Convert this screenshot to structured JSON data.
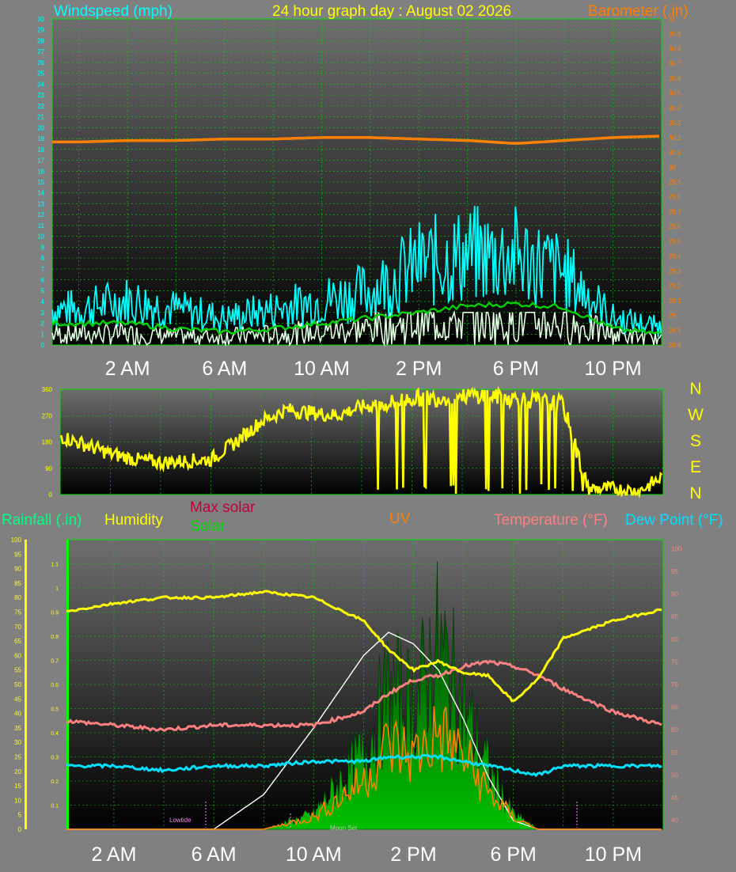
{
  "header": {
    "title": "24 hour graph day : August 02 2026",
    "left_label": "Windspeed (mph)",
    "right_label": "Barometer (.in)"
  },
  "time_labels": [
    "2 AM",
    "6 AM",
    "10 AM",
    "2 PM",
    "6 PM",
    "10 PM"
  ],
  "legend": {
    "rainfall": "Rainfall (.in)",
    "humidity": "Humidity",
    "max_solar": "Max solar",
    "solar": "Solar",
    "uv": "UV",
    "temperature": "Temperature (°F)",
    "dew_point": "Dew Point (°F)"
  },
  "direction_letters": [
    "N",
    "W",
    "S",
    "E",
    "N"
  ],
  "annotations": {
    "lowtide": "Lowtide",
    "moonset": "Moon Set"
  },
  "colors": {
    "background": "#808080",
    "plot_top": "#707070",
    "plot_bottom": "#000000",
    "grid": "#00e000",
    "wind": "#00ffff",
    "gust_white": "#e0ffe0",
    "wind_avg": "#00d000",
    "barometer": "#ff8000",
    "direction": "#ffff00",
    "humidity": "#ffff00",
    "temperature": "#ff8080",
    "dew_point": "#00e0ff",
    "uv": "#ff8000",
    "solar": "#00a000",
    "max_solar": "#ffffff",
    "rain_axis": "#ffff00",
    "marker": "#ff80ff"
  },
  "chart_data": [
    {
      "type": "line",
      "name": "wind_barometer",
      "x_hours": [
        0,
        2,
        4,
        6,
        8,
        10,
        12,
        14,
        16,
        18,
        20,
        22,
        24
      ],
      "left_axis": {
        "ticks": [
          0,
          1,
          2,
          3,
          4,
          5,
          6,
          7,
          8,
          9,
          10,
          11,
          12,
          13,
          14,
          15,
          16,
          17,
          18,
          19,
          20,
          21,
          22,
          23,
          24,
          25,
          26,
          27,
          28,
          29,
          30
        ],
        "ylim": [
          0,
          30
        ]
      },
      "right_axis": {
        "ticks": [
          "28.8",
          "28.9",
          "29",
          "29.1",
          "29.2",
          "29.3",
          "29.4",
          "29.5",
          "29.6",
          "29.7",
          "29.8",
          "29.9",
          "30",
          "30.1",
          "30.2",
          "30.3",
          "30.4",
          "30.5",
          "30.6",
          "30.7",
          "30.8",
          "30.9",
          "31"
        ],
        "ylim": [
          28.8,
          31
        ]
      },
      "series": [
        {
          "key": "wind_gust",
          "values": [
            4,
            5,
            4,
            3,
            4,
            5,
            6,
            9,
            10,
            10,
            8,
            3,
            2
          ]
        },
        {
          "key": "wind_avg",
          "values": [
            2,
            2,
            1.5,
            1.2,
            1.5,
            2,
            2.5,
            3,
            3.6,
            3.8,
            3.5,
            1.5,
            1
          ]
        },
        {
          "key": "wind_speed",
          "values": [
            1,
            1,
            0.8,
            0.8,
            1,
            1.2,
            1.5,
            2,
            2.3,
            2.3,
            2,
            1,
            0.5
          ]
        },
        {
          "key": "barometer",
          "values": [
            30.17,
            30.18,
            30.18,
            30.19,
            30.19,
            30.2,
            30.2,
            30.19,
            30.18,
            30.16,
            30.18,
            30.2,
            30.21
          ]
        }
      ]
    },
    {
      "type": "line",
      "name": "wind_direction",
      "x_hours": [
        0,
        1,
        2,
        3,
        4,
        5,
        6,
        7,
        8,
        9,
        10,
        11,
        12,
        13,
        14,
        15,
        16,
        17,
        18,
        19,
        20,
        21,
        22,
        23,
        24
      ],
      "axis": {
        "ticks": [
          0,
          90,
          180,
          270,
          360
        ],
        "ylim": [
          0,
          360
        ]
      },
      "values": [
        200,
        170,
        140,
        120,
        110,
        115,
        120,
        180,
        250,
        290,
        280,
        270,
        300,
        310,
        330,
        330,
        340,
        340,
        330,
        320,
        310,
        20,
        20,
        10,
        60
      ]
    },
    {
      "type": "line",
      "name": "temperature_humidity",
      "x_hours": [
        0,
        2,
        4,
        6,
        8,
        10,
        12,
        13,
        14,
        15,
        16,
        17,
        18,
        19,
        20,
        22,
        24
      ],
      "left_axis": {
        "ticks": [
          0,
          5,
          10,
          15,
          20,
          25,
          30,
          35,
          40,
          45,
          50,
          55,
          60,
          65,
          70,
          75,
          80,
          85,
          90,
          95,
          100
        ],
        "ylim": [
          0,
          100
        ]
      },
      "rain_axis": {
        "ticks": [
          "0.1",
          "0.2",
          "0.3",
          "0.4",
          "0.5",
          "0.6",
          "0.7",
          "0.8",
          "0.9",
          "1",
          "1.1"
        ],
        "ylim": [
          0,
          1.2
        ]
      },
      "right_axis": {
        "ticks": [
          40,
          45,
          50,
          55,
          60,
          65,
          70,
          75,
          80,
          85,
          90,
          95,
          100
        ],
        "ylim": [
          38,
          102
        ]
      },
      "series": [
        {
          "key": "humidity",
          "values": [
            75,
            78,
            80,
            80,
            82,
            80,
            72,
            62,
            55,
            58,
            54,
            53,
            44,
            52,
            66,
            72,
            76
          ]
        },
        {
          "key": "temperature",
          "values": [
            62,
            61,
            60,
            61,
            61,
            61,
            64,
            68,
            71,
            72,
            74,
            75,
            74,
            72,
            69,
            64,
            61
          ]
        },
        {
          "key": "dew_point",
          "values": [
            52,
            52,
            51,
            52,
            52,
            53,
            53,
            54,
            54,
            54,
            53,
            52,
            51,
            50,
            52,
            52,
            52
          ]
        },
        {
          "key": "uv",
          "values": [
            0,
            0,
            0,
            0,
            0,
            0.05,
            0.2,
            0.35,
            0.3,
            0.4,
            0.3,
            0.15,
            0.05,
            0,
            0,
            0,
            0
          ]
        },
        {
          "key": "solar",
          "values": [
            0,
            0,
            0,
            0,
            0,
            5,
            25,
            45,
            40,
            60,
            40,
            20,
            5,
            0,
            0,
            0,
            0
          ]
        },
        {
          "key": "max_solar",
          "values": [
            0,
            0,
            0,
            0,
            12,
            35,
            60,
            68,
            64,
            55,
            38,
            18,
            3,
            0,
            0,
            0,
            0
          ]
        }
      ]
    }
  ]
}
